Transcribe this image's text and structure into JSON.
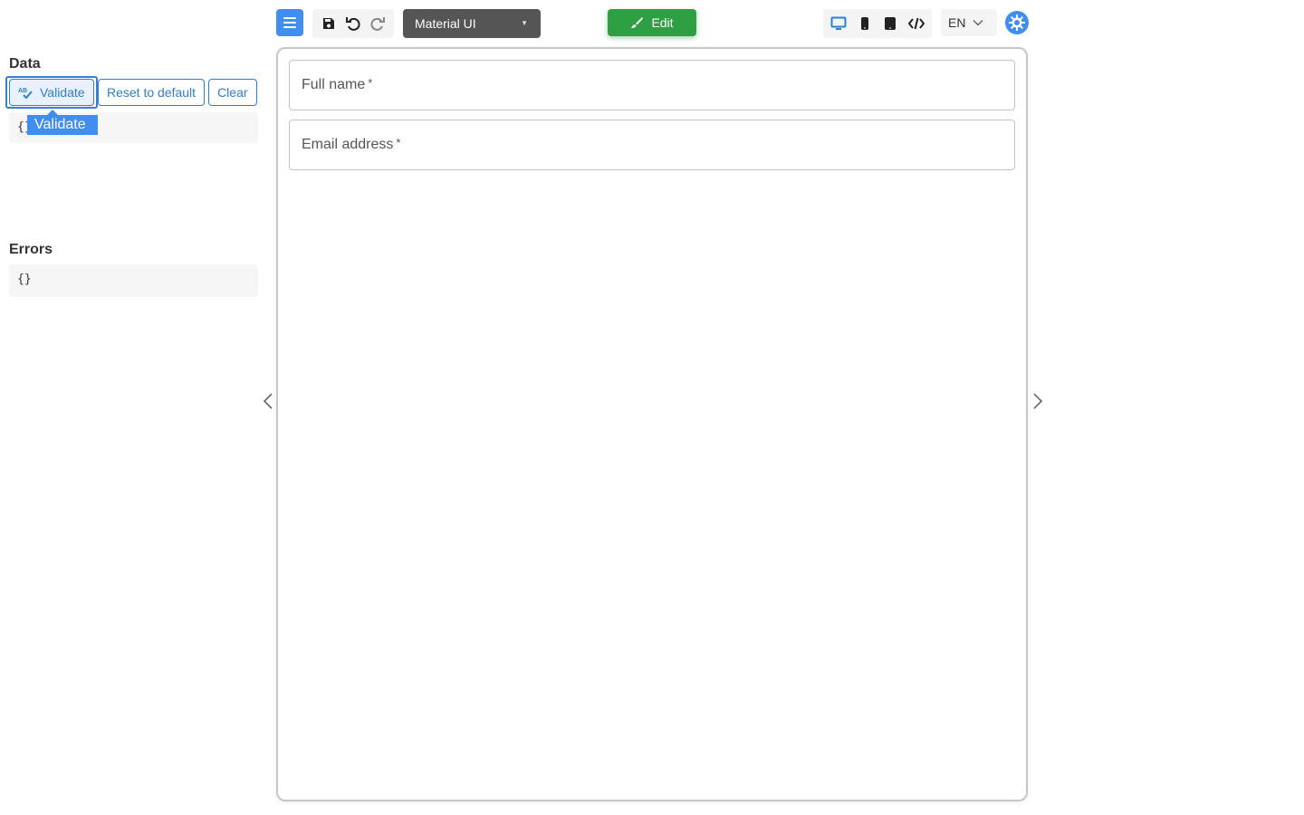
{
  "toolbar": {
    "menu_icon": "hamburger-menu-icon",
    "save_icon": "floppy-disk-icon",
    "undo_icon": "undo-icon",
    "redo_icon": "redo-icon",
    "theme_select": {
      "value": "Material UI"
    },
    "edit_button": {
      "label": "Edit",
      "icon": "paintbrush-icon"
    },
    "device_icons": [
      "desktop-icon",
      "mobile-icon",
      "tablet-icon",
      "code-icon"
    ],
    "language_select": {
      "value": "EN"
    },
    "settings_icon": "gear-icon"
  },
  "left_panel": {
    "data_title": "Data",
    "buttons": {
      "validate": "Validate",
      "reset": "Reset to default",
      "clear": "Clear"
    },
    "data_json": "{}",
    "tooltip": "Validate",
    "errors_title": "Errors",
    "errors_json": "{}"
  },
  "form": {
    "fields": [
      {
        "label": "Full name",
        "required_mark": "*"
      },
      {
        "label": "Email address",
        "required_mark": "*"
      }
    ]
  },
  "colors": {
    "primary": "#3f8ef0",
    "link_blue": "#2b7fd4",
    "edit_green": "#2ea043",
    "select_dark": "#555555"
  }
}
